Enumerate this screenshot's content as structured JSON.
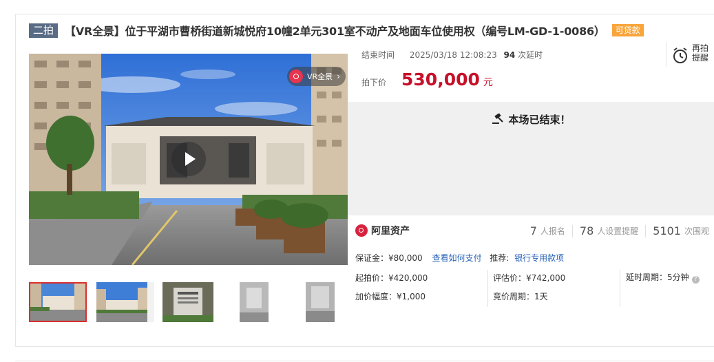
{
  "auction": {
    "round_tag": "二拍",
    "title": "【VR全景】位于平湖市曹桥街道新城悦府10幢2单元301室不动产及地面车位使用权（编号LM-GD-1-0086）",
    "loan_tag": "可贷款"
  },
  "media": {
    "vr_label": "VR全景",
    "vr_arrow": "›",
    "thumbnails": [
      {
        "kind": "exterior-front",
        "active": true
      },
      {
        "kind": "exterior-wide",
        "active": false
      },
      {
        "kind": "sign-board",
        "active": false
      },
      {
        "kind": "interior-room",
        "active": false
      },
      {
        "kind": "interior-room",
        "active": false
      }
    ]
  },
  "status": {
    "end_time_label": "结束时间",
    "end_time": "2025/03/18 12:08:23",
    "delay_count": "94",
    "delay_label": "次延时",
    "remind_label": "再拍提醒",
    "sold_price_label": "拍下价",
    "sold_price": "530,000",
    "sold_price_unit": "元",
    "ended_text": "本场已结束！"
  },
  "platform": {
    "name": "阿里资产",
    "stats": [
      {
        "value": "7",
        "label": "人报名"
      },
      {
        "value": "78",
        "label": "人设置提醒"
      },
      {
        "value": "5101",
        "label": "次围观"
      }
    ]
  },
  "terms": {
    "deposit": "保证金：¥80,000",
    "pay_link": "查看如何支付",
    "recommend_label": "推荐:",
    "recommend_link": "银行专用款项",
    "start_price": "起拍价：¥420,000",
    "assessed_price": "评估价：¥742,000",
    "delay_period": "延时周期：5分钟",
    "increment": "加价幅度：¥1,000",
    "bid_period": "竞价周期：1天"
  },
  "colors": {
    "price": "#c6102a",
    "link": "#2a63b8",
    "round_tag_bg": "#5a6b86",
    "loan_tag_bg": "#f9a53b"
  }
}
